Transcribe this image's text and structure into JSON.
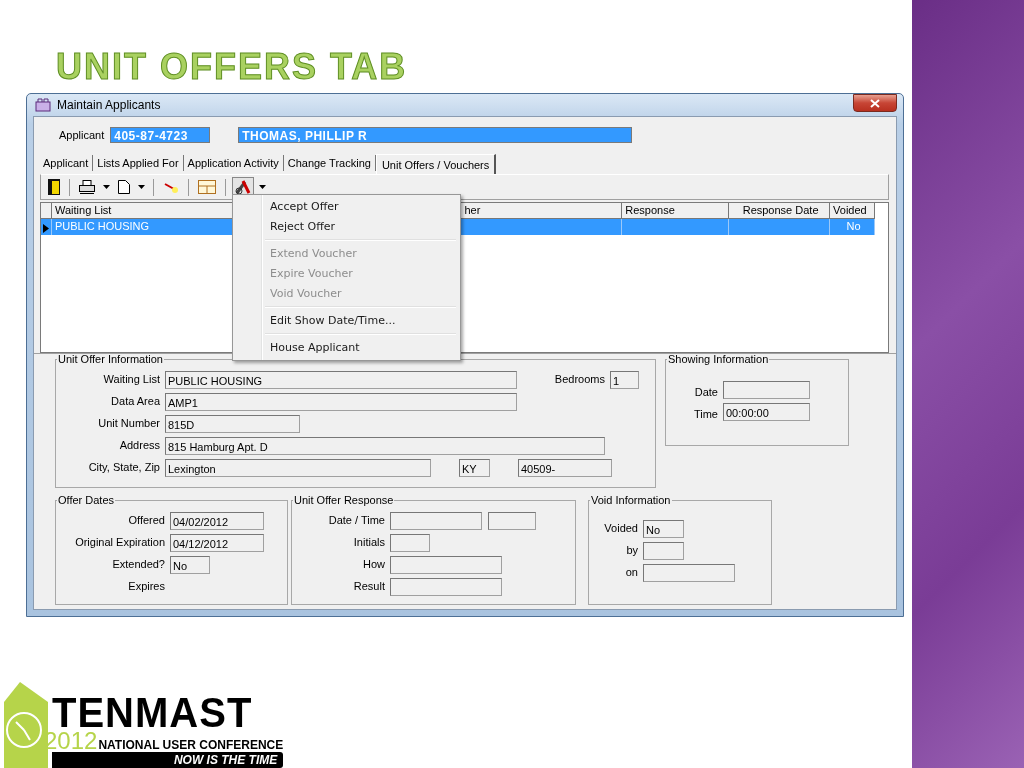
{
  "slide_title": "UNIT OFFERS TAB",
  "window": {
    "title": "Maintain Applicants"
  },
  "applicant": {
    "label": "Applicant",
    "id": "405-87-4723",
    "name": "THOMAS, PHILLIP R"
  },
  "tabs": [
    {
      "label": "Applicant",
      "selected": false
    },
    {
      "label": "Lists Applied For",
      "selected": false
    },
    {
      "label": "Application Activity",
      "selected": false
    },
    {
      "label": "Change Tracking",
      "selected": false
    },
    {
      "label": "Unit Offers / Vouchers",
      "selected": true
    }
  ],
  "grid": {
    "columns": [
      "Waiting List",
      "her",
      "Response",
      "Response Date",
      "Voided"
    ],
    "rows": [
      {
        "cells": [
          "PUBLIC HOUSING",
          "",
          "",
          "",
          "No"
        ],
        "selected": true
      }
    ]
  },
  "context_menu": {
    "groups": [
      [
        {
          "label": "Accept Offer",
          "disabled": false
        },
        {
          "label": "Reject Offer",
          "disabled": false
        }
      ],
      [
        {
          "label": "Extend Voucher",
          "disabled": true
        },
        {
          "label": "Expire Voucher",
          "disabled": true
        },
        {
          "label": "Void Voucher",
          "disabled": true
        }
      ],
      [
        {
          "label": "Edit Show Date/Time...",
          "disabled": false
        }
      ],
      [
        {
          "label": "House Applicant",
          "disabled": false
        }
      ]
    ]
  },
  "unit_offer_information": {
    "title": "Unit Offer Information",
    "rows": [
      [
        {
          "label": "Waiting List",
          "fields": [
            {
              "kind": "text_box",
              "value": "PUBLIC HOUSING"
            }
          ]
        },
        {
          "label": "Bedrooms",
          "fields": [
            {
              "kind": "text_box",
              "value": "1"
            }
          ]
        }
      ],
      [
        {
          "label": "Data Area",
          "fields": [
            {
              "kind": "text_box",
              "value": "AMP1"
            }
          ]
        }
      ],
      [
        {
          "label": "Unit Number",
          "fields": [
            {
              "kind": "text_box",
              "value": "815D"
            }
          ]
        }
      ],
      [
        {
          "label": "Address",
          "fields": [
            {
              "kind": "text_box",
              "value": "815 Hamburg Apt. D"
            }
          ]
        }
      ],
      [
        {
          "label": "City, State, Zip",
          "fields": [
            {
              "kind": "text_box",
              "value": "Lexington"
            },
            {
              "kind": "text_box",
              "value": "KY"
            },
            {
              "kind": "text_box",
              "value": "40509-"
            }
          ]
        }
      ]
    ]
  },
  "showing_information": {
    "title": "Showing Information",
    "rows": [
      {
        "label": "Date",
        "fields": [
          {
            "kind": "text_box"
          }
        ]
      },
      {
        "label": "Time",
        "fields": [
          {
            "kind": "text_box",
            "value": "00:00:00"
          }
        ]
      }
    ]
  },
  "offer_dates": {
    "title": "Offer Dates",
    "rows": [
      {
        "label": "Offered",
        "fields": [
          {
            "kind": "text_box",
            "value": "04/02/2012"
          }
        ]
      },
      {
        "label": "Original Expiration",
        "fields": [
          {
            "kind": "text_box",
            "value": "04/12/2012"
          }
        ]
      },
      {
        "label": "Extended?",
        "fields": [
          {
            "kind": "text_box",
            "value": "No"
          }
        ]
      },
      {
        "label": "Expires",
        "fields": []
      }
    ]
  },
  "unit_offer_response": {
    "title": "Unit Offer Response",
    "rows": [
      {
        "label": "Date / Time",
        "fields": [
          {
            "kind": "text_box"
          },
          {
            "kind": "text_box"
          }
        ]
      },
      {
        "label": "Initials",
        "fields": [
          {
            "kind": "text_box"
          }
        ]
      },
      {
        "label": "How",
        "fields": [
          {
            "kind": "text_box"
          }
        ]
      },
      {
        "label": "Result",
        "fields": [
          {
            "kind": "text_box"
          }
        ]
      }
    ]
  },
  "void_information": {
    "title": "Void Information",
    "rows": [
      {
        "label": "Voided",
        "fields": [
          {
            "kind": "text_box",
            "value": "No"
          }
        ]
      },
      {
        "label": "by",
        "fields": [
          {
            "kind": "text_box"
          }
        ]
      },
      {
        "label": "on",
        "fields": [
          {
            "kind": "text_box"
          }
        ]
      }
    ]
  },
  "logo": {
    "brand": "TENMAST",
    "year": "2012",
    "subtitle": "NATIONAL USER CONFERENCE",
    "tagline": "NOW IS THE TIME"
  }
}
